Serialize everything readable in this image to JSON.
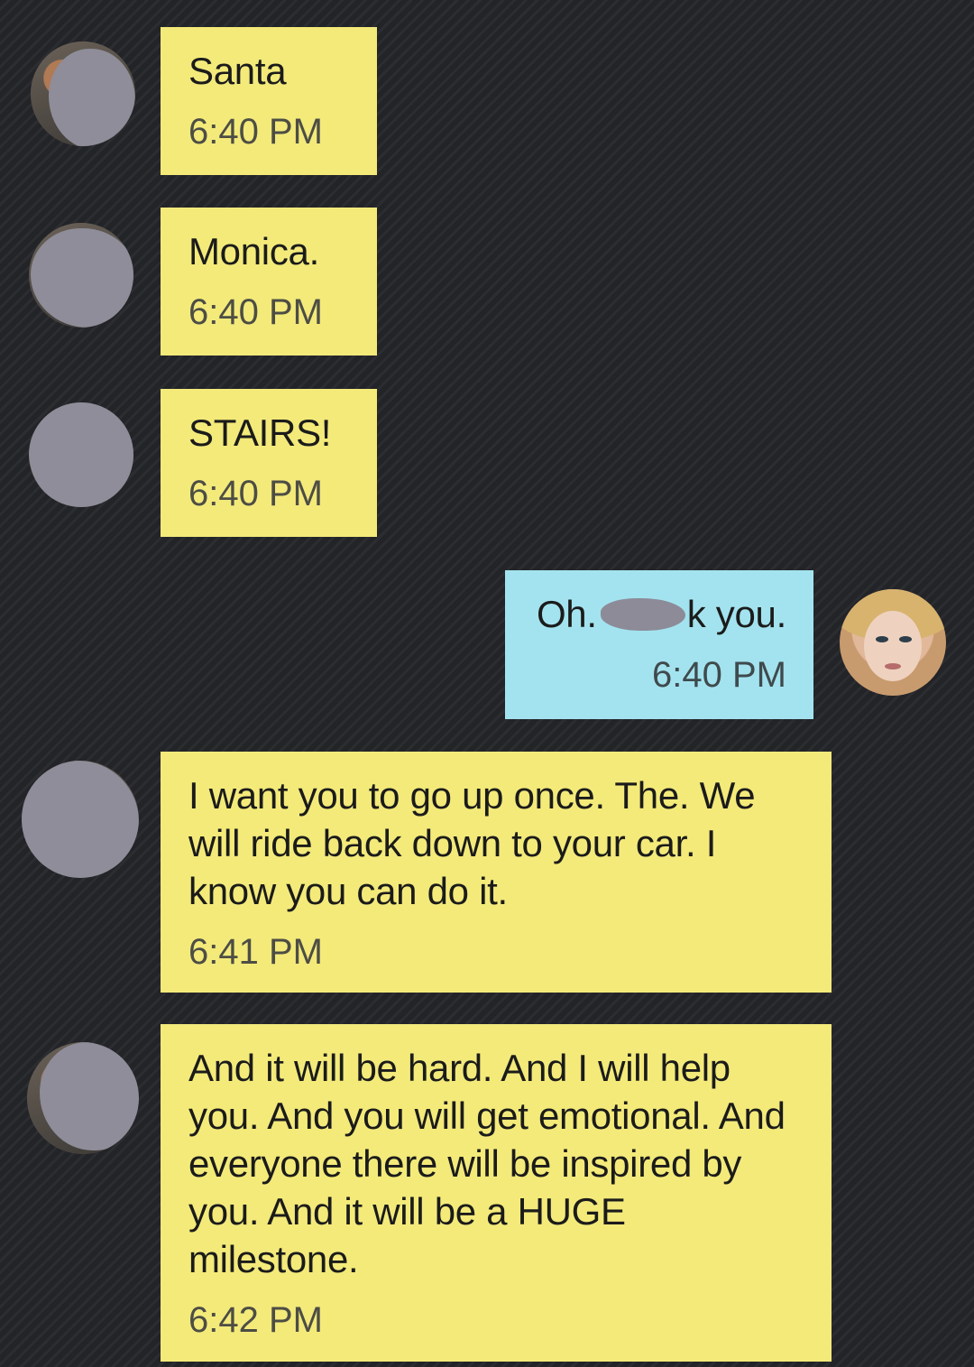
{
  "thread": {
    "messages": [
      {
        "direction": "incoming",
        "text": "Santa",
        "time": "6:40 PM"
      },
      {
        "direction": "incoming",
        "text": "Monica.",
        "time": "6:40 PM"
      },
      {
        "direction": "incoming",
        "text": "STAIRS!",
        "time": "6:40 PM"
      },
      {
        "direction": "outgoing",
        "text_before": "Oh.",
        "text_after": "k you.",
        "time": "6:40 PM"
      },
      {
        "direction": "incoming",
        "text": "I want you to go up once. The. We will ride back down to your car. I know you can do it.",
        "time": "6:41 PM"
      },
      {
        "direction": "incoming",
        "text": "And it will be hard. And I will help you. And you will get emotional. And everyone there will be inspired by you. And it will be a HUGE milestone.",
        "time": "6:42 PM"
      }
    ]
  },
  "colors": {
    "background": "#26272b",
    "incoming_bubble": "#f3ea7a",
    "outgoing_bubble": "#a3e3ef",
    "redaction": "#8e8d99"
  }
}
